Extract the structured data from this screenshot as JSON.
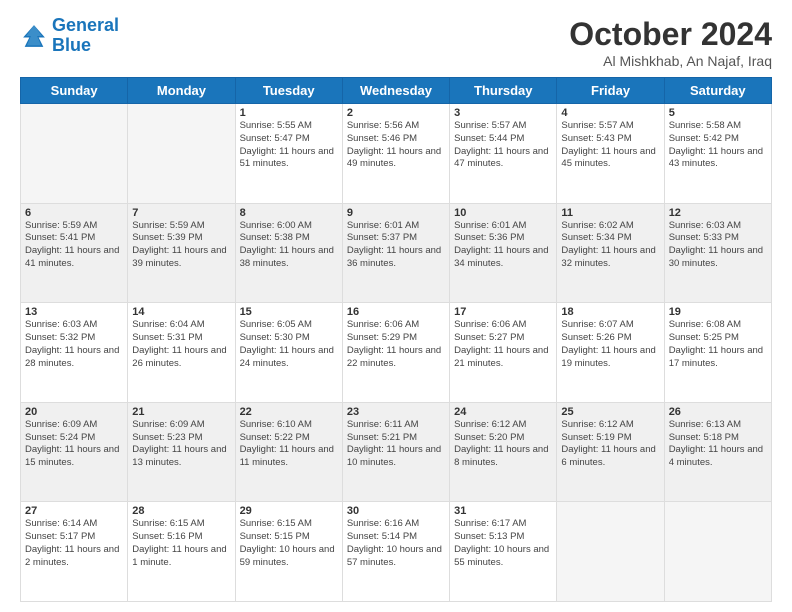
{
  "header": {
    "logo_line1": "General",
    "logo_line2": "Blue",
    "month": "October 2024",
    "location": "Al Mishkhab, An Najaf, Iraq"
  },
  "days_of_week": [
    "Sunday",
    "Monday",
    "Tuesday",
    "Wednesday",
    "Thursday",
    "Friday",
    "Saturday"
  ],
  "weeks": [
    [
      {
        "day": "",
        "sunrise": "",
        "sunset": "",
        "daylight": ""
      },
      {
        "day": "",
        "sunrise": "",
        "sunset": "",
        "daylight": ""
      },
      {
        "day": "1",
        "sunrise": "Sunrise: 5:55 AM",
        "sunset": "Sunset: 5:47 PM",
        "daylight": "Daylight: 11 hours and 51 minutes."
      },
      {
        "day": "2",
        "sunrise": "Sunrise: 5:56 AM",
        "sunset": "Sunset: 5:46 PM",
        "daylight": "Daylight: 11 hours and 49 minutes."
      },
      {
        "day": "3",
        "sunrise": "Sunrise: 5:57 AM",
        "sunset": "Sunset: 5:44 PM",
        "daylight": "Daylight: 11 hours and 47 minutes."
      },
      {
        "day": "4",
        "sunrise": "Sunrise: 5:57 AM",
        "sunset": "Sunset: 5:43 PM",
        "daylight": "Daylight: 11 hours and 45 minutes."
      },
      {
        "day": "5",
        "sunrise": "Sunrise: 5:58 AM",
        "sunset": "Sunset: 5:42 PM",
        "daylight": "Daylight: 11 hours and 43 minutes."
      }
    ],
    [
      {
        "day": "6",
        "sunrise": "Sunrise: 5:59 AM",
        "sunset": "Sunset: 5:41 PM",
        "daylight": "Daylight: 11 hours and 41 minutes."
      },
      {
        "day": "7",
        "sunrise": "Sunrise: 5:59 AM",
        "sunset": "Sunset: 5:39 PM",
        "daylight": "Daylight: 11 hours and 39 minutes."
      },
      {
        "day": "8",
        "sunrise": "Sunrise: 6:00 AM",
        "sunset": "Sunset: 5:38 PM",
        "daylight": "Daylight: 11 hours and 38 minutes."
      },
      {
        "day": "9",
        "sunrise": "Sunrise: 6:01 AM",
        "sunset": "Sunset: 5:37 PM",
        "daylight": "Daylight: 11 hours and 36 minutes."
      },
      {
        "day": "10",
        "sunrise": "Sunrise: 6:01 AM",
        "sunset": "Sunset: 5:36 PM",
        "daylight": "Daylight: 11 hours and 34 minutes."
      },
      {
        "day": "11",
        "sunrise": "Sunrise: 6:02 AM",
        "sunset": "Sunset: 5:34 PM",
        "daylight": "Daylight: 11 hours and 32 minutes."
      },
      {
        "day": "12",
        "sunrise": "Sunrise: 6:03 AM",
        "sunset": "Sunset: 5:33 PM",
        "daylight": "Daylight: 11 hours and 30 minutes."
      }
    ],
    [
      {
        "day": "13",
        "sunrise": "Sunrise: 6:03 AM",
        "sunset": "Sunset: 5:32 PM",
        "daylight": "Daylight: 11 hours and 28 minutes."
      },
      {
        "day": "14",
        "sunrise": "Sunrise: 6:04 AM",
        "sunset": "Sunset: 5:31 PM",
        "daylight": "Daylight: 11 hours and 26 minutes."
      },
      {
        "day": "15",
        "sunrise": "Sunrise: 6:05 AM",
        "sunset": "Sunset: 5:30 PM",
        "daylight": "Daylight: 11 hours and 24 minutes."
      },
      {
        "day": "16",
        "sunrise": "Sunrise: 6:06 AM",
        "sunset": "Sunset: 5:29 PM",
        "daylight": "Daylight: 11 hours and 22 minutes."
      },
      {
        "day": "17",
        "sunrise": "Sunrise: 6:06 AM",
        "sunset": "Sunset: 5:27 PM",
        "daylight": "Daylight: 11 hours and 21 minutes."
      },
      {
        "day": "18",
        "sunrise": "Sunrise: 6:07 AM",
        "sunset": "Sunset: 5:26 PM",
        "daylight": "Daylight: 11 hours and 19 minutes."
      },
      {
        "day": "19",
        "sunrise": "Sunrise: 6:08 AM",
        "sunset": "Sunset: 5:25 PM",
        "daylight": "Daylight: 11 hours and 17 minutes."
      }
    ],
    [
      {
        "day": "20",
        "sunrise": "Sunrise: 6:09 AM",
        "sunset": "Sunset: 5:24 PM",
        "daylight": "Daylight: 11 hours and 15 minutes."
      },
      {
        "day": "21",
        "sunrise": "Sunrise: 6:09 AM",
        "sunset": "Sunset: 5:23 PM",
        "daylight": "Daylight: 11 hours and 13 minutes."
      },
      {
        "day": "22",
        "sunrise": "Sunrise: 6:10 AM",
        "sunset": "Sunset: 5:22 PM",
        "daylight": "Daylight: 11 hours and 11 minutes."
      },
      {
        "day": "23",
        "sunrise": "Sunrise: 6:11 AM",
        "sunset": "Sunset: 5:21 PM",
        "daylight": "Daylight: 11 hours and 10 minutes."
      },
      {
        "day": "24",
        "sunrise": "Sunrise: 6:12 AM",
        "sunset": "Sunset: 5:20 PM",
        "daylight": "Daylight: 11 hours and 8 minutes."
      },
      {
        "day": "25",
        "sunrise": "Sunrise: 6:12 AM",
        "sunset": "Sunset: 5:19 PM",
        "daylight": "Daylight: 11 hours and 6 minutes."
      },
      {
        "day": "26",
        "sunrise": "Sunrise: 6:13 AM",
        "sunset": "Sunset: 5:18 PM",
        "daylight": "Daylight: 11 hours and 4 minutes."
      }
    ],
    [
      {
        "day": "27",
        "sunrise": "Sunrise: 6:14 AM",
        "sunset": "Sunset: 5:17 PM",
        "daylight": "Daylight: 11 hours and 2 minutes."
      },
      {
        "day": "28",
        "sunrise": "Sunrise: 6:15 AM",
        "sunset": "Sunset: 5:16 PM",
        "daylight": "Daylight: 11 hours and 1 minute."
      },
      {
        "day": "29",
        "sunrise": "Sunrise: 6:15 AM",
        "sunset": "Sunset: 5:15 PM",
        "daylight": "Daylight: 10 hours and 59 minutes."
      },
      {
        "day": "30",
        "sunrise": "Sunrise: 6:16 AM",
        "sunset": "Sunset: 5:14 PM",
        "daylight": "Daylight: 10 hours and 57 minutes."
      },
      {
        "day": "31",
        "sunrise": "Sunrise: 6:17 AM",
        "sunset": "Sunset: 5:13 PM",
        "daylight": "Daylight: 10 hours and 55 minutes."
      },
      {
        "day": "",
        "sunrise": "",
        "sunset": "",
        "daylight": ""
      },
      {
        "day": "",
        "sunrise": "",
        "sunset": "",
        "daylight": ""
      }
    ]
  ]
}
